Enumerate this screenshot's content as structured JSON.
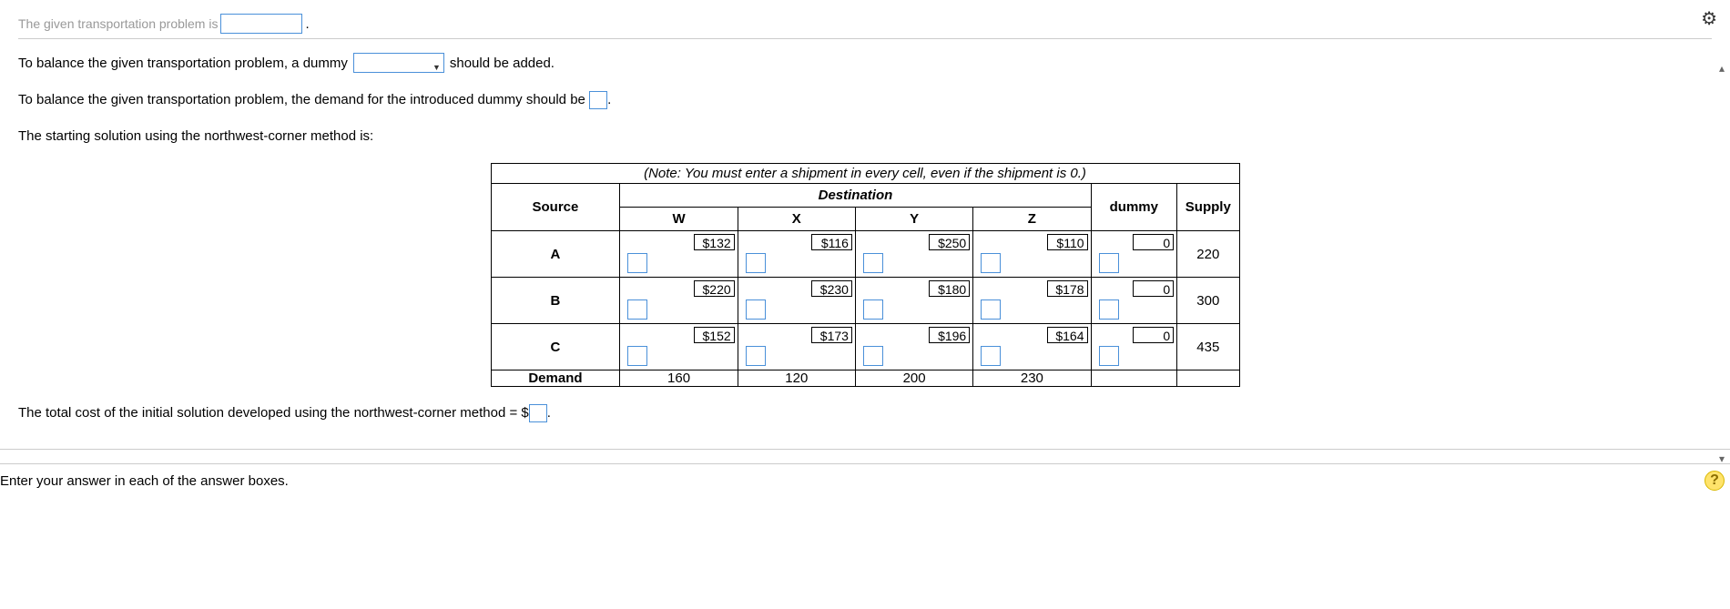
{
  "cutoff_text": "The given transportation problem is",
  "line1_pre": "To balance the given transportation problem, a dummy",
  "line1_post": "should be added.",
  "line2_pre": "To balance the given transportation problem, the demand for the introduced dummy should be",
  "line2_post": ".",
  "line3": "The starting solution using the northwest-corner method is:",
  "note": "(Note: You must enter a shipment in every cell, even if the shipment is 0.)",
  "destination_header": "Destination",
  "table": {
    "source_header": "Source",
    "dest_cols": [
      "W",
      "X",
      "Y",
      "Z"
    ],
    "dummy_col": "dummy",
    "supply_col": "Supply",
    "rows": [
      {
        "src": "A",
        "costs": [
          "$132",
          "$116",
          "$250",
          "$110",
          "0"
        ],
        "supply": "220"
      },
      {
        "src": "B",
        "costs": [
          "$220",
          "$230",
          "$180",
          "$178",
          "0"
        ],
        "supply": "300"
      },
      {
        "src": "C",
        "costs": [
          "$152",
          "$173",
          "$196",
          "$164",
          "0"
        ],
        "supply": "435"
      }
    ],
    "demand_label": "Demand",
    "demand": [
      "160",
      "120",
      "200",
      "230",
      "",
      ""
    ]
  },
  "total_cost_pre": "The total cost of the initial solution developed using the northwest-corner method = $",
  "total_cost_post": ".",
  "footer_note": "Enter your answer in each of the answer boxes.",
  "icons": {
    "gear": "⚙",
    "help": "?",
    "up": "▴",
    "down": "▾"
  }
}
